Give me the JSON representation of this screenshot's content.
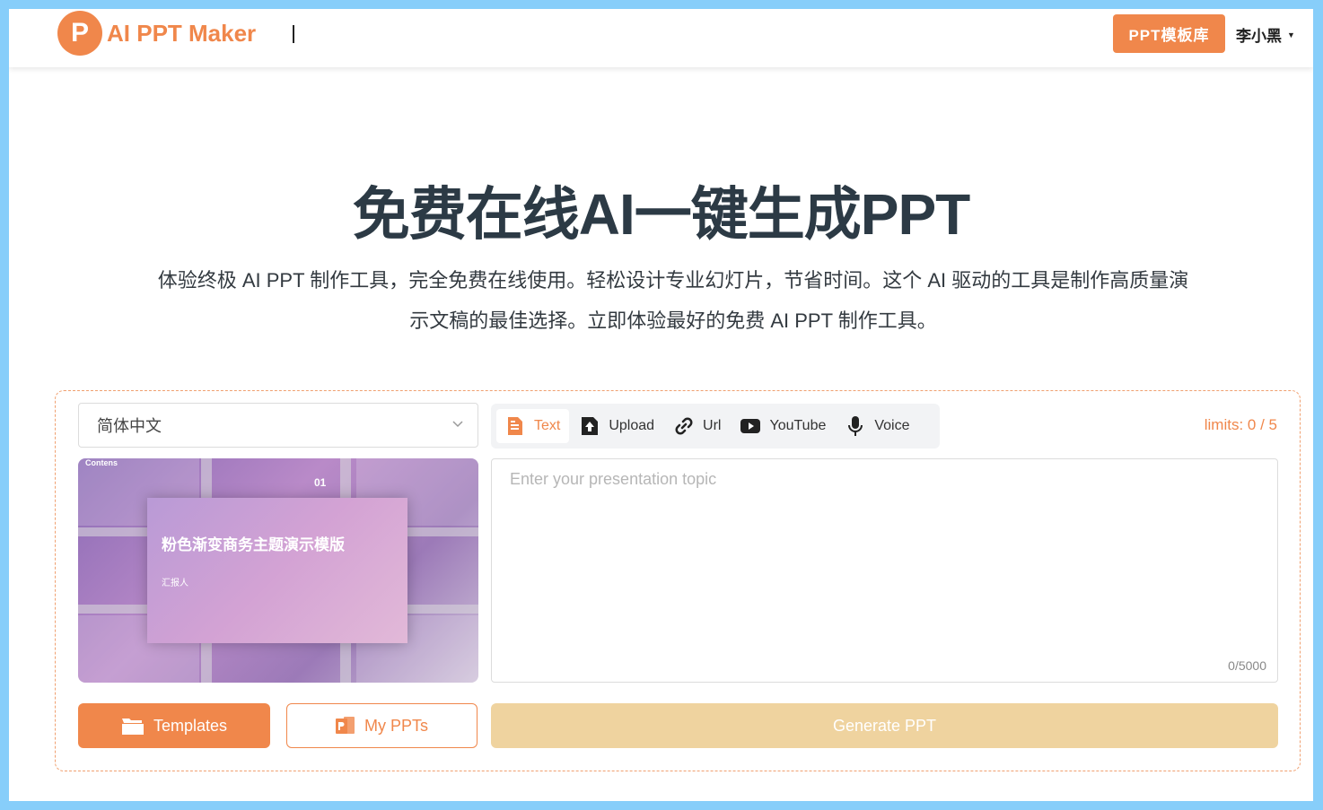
{
  "colors": {
    "accent": "#f0874b",
    "generate_disabled": "#efd39f",
    "page_bg": "#87cefa",
    "title": "#2c3a45"
  },
  "header": {
    "logo_letter": "P",
    "logo_text": "AI PPT Maker",
    "template_library_label": "PPT模板库",
    "user_name": "李小黑"
  },
  "hero": {
    "title": "免费在线AI一键生成PPT",
    "subtitle": "体验终极 AI PPT 制作工具，完全免费在线使用。轻松设计专业幻灯片，节省时间。这个 AI 驱动的工具是制作高质量演示文稿的最佳选择。立即体验最好的免费 AI PPT 制作工具。"
  },
  "panel": {
    "language": {
      "selected": "简体中文"
    },
    "tabs": [
      {
        "label": "Text",
        "icon": "document-icon",
        "active": true
      },
      {
        "label": "Upload",
        "icon": "upload-icon",
        "active": false
      },
      {
        "label": "Url",
        "icon": "link-icon",
        "active": false
      },
      {
        "label": "YouTube",
        "icon": "youtube-icon",
        "active": false
      },
      {
        "label": "Voice",
        "icon": "microphone-icon",
        "active": false
      }
    ],
    "limits": "limits: 0 / 5",
    "preview": {
      "title": "粉色渐变商务主题演示模版",
      "reporter": "汇报人",
      "contents": "Contens",
      "number": "01"
    },
    "topic": {
      "placeholder": "Enter your presentation topic",
      "value": "",
      "count": "0/5000"
    },
    "buttons": {
      "templates": "Templates",
      "my_ppts": "My PPTs",
      "generate": "Generate PPT"
    }
  }
}
